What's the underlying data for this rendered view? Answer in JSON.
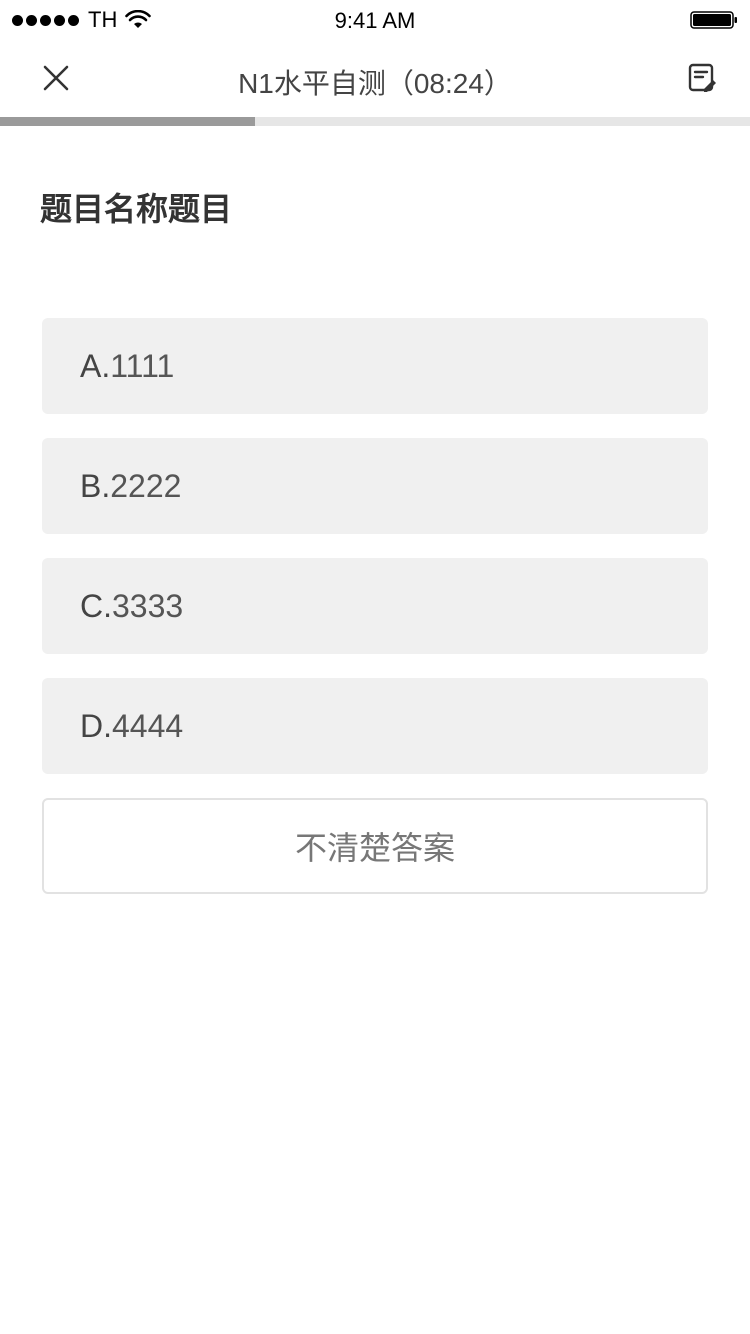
{
  "status_bar": {
    "carrier": "TH",
    "time": "9:41 AM"
  },
  "nav": {
    "title": "N1水平自测（08:24）",
    "close_icon": "close-icon",
    "notes_icon": "answer-sheet-icon"
  },
  "progress": {
    "fraction": 0.34,
    "fill_color": "#9a9a9a",
    "track_color": "#e6e6e6"
  },
  "question": {
    "title": "题目名称题目"
  },
  "options": [
    {
      "letter": "A.",
      "text": "1111"
    },
    {
      "letter": "B.",
      "text": "2222"
    },
    {
      "letter": "C.",
      "text": "3333"
    },
    {
      "letter": "D.",
      "text": "4444"
    }
  ],
  "unsure_button": {
    "label": "不清楚答案"
  }
}
